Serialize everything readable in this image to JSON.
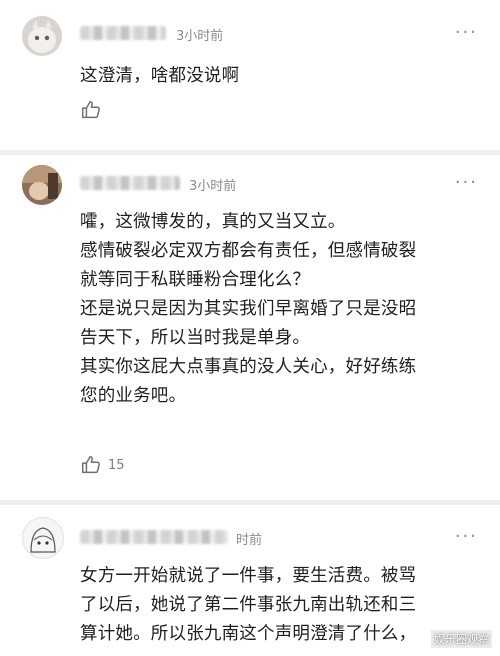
{
  "comments": [
    {
      "time": "3小时前",
      "more_label": "···",
      "lines": [
        "这澄清，啥都没说啊"
      ],
      "like_count": ""
    },
    {
      "time": "3小时前",
      "more_label": "···",
      "lines": [
        "嚯，这微博发的，真的又当又立。",
        "感情破裂必定双方都会有责任，但感情破裂",
        "就等同于私联睡粉合理化么？",
        "还是说只是因为其实我们早离婚了只是没昭",
        "告天下，所以当时我是单身。",
        "其实你这屁大点事真的没人关心，好好练练",
        "您的业务吧。"
      ],
      "like_count": "15"
    },
    {
      "time": "时前",
      "more_label": "···",
      "lines": [
        "女方一开始就说了一件事，要生活费。被骂",
        "了以后，她说了第二件事张九南出轨还和三",
        "算计她。所以张九南这个声明澄清了什么，"
      ],
      "like_count": ""
    }
  ],
  "watermark": "娱乐圈观察"
}
